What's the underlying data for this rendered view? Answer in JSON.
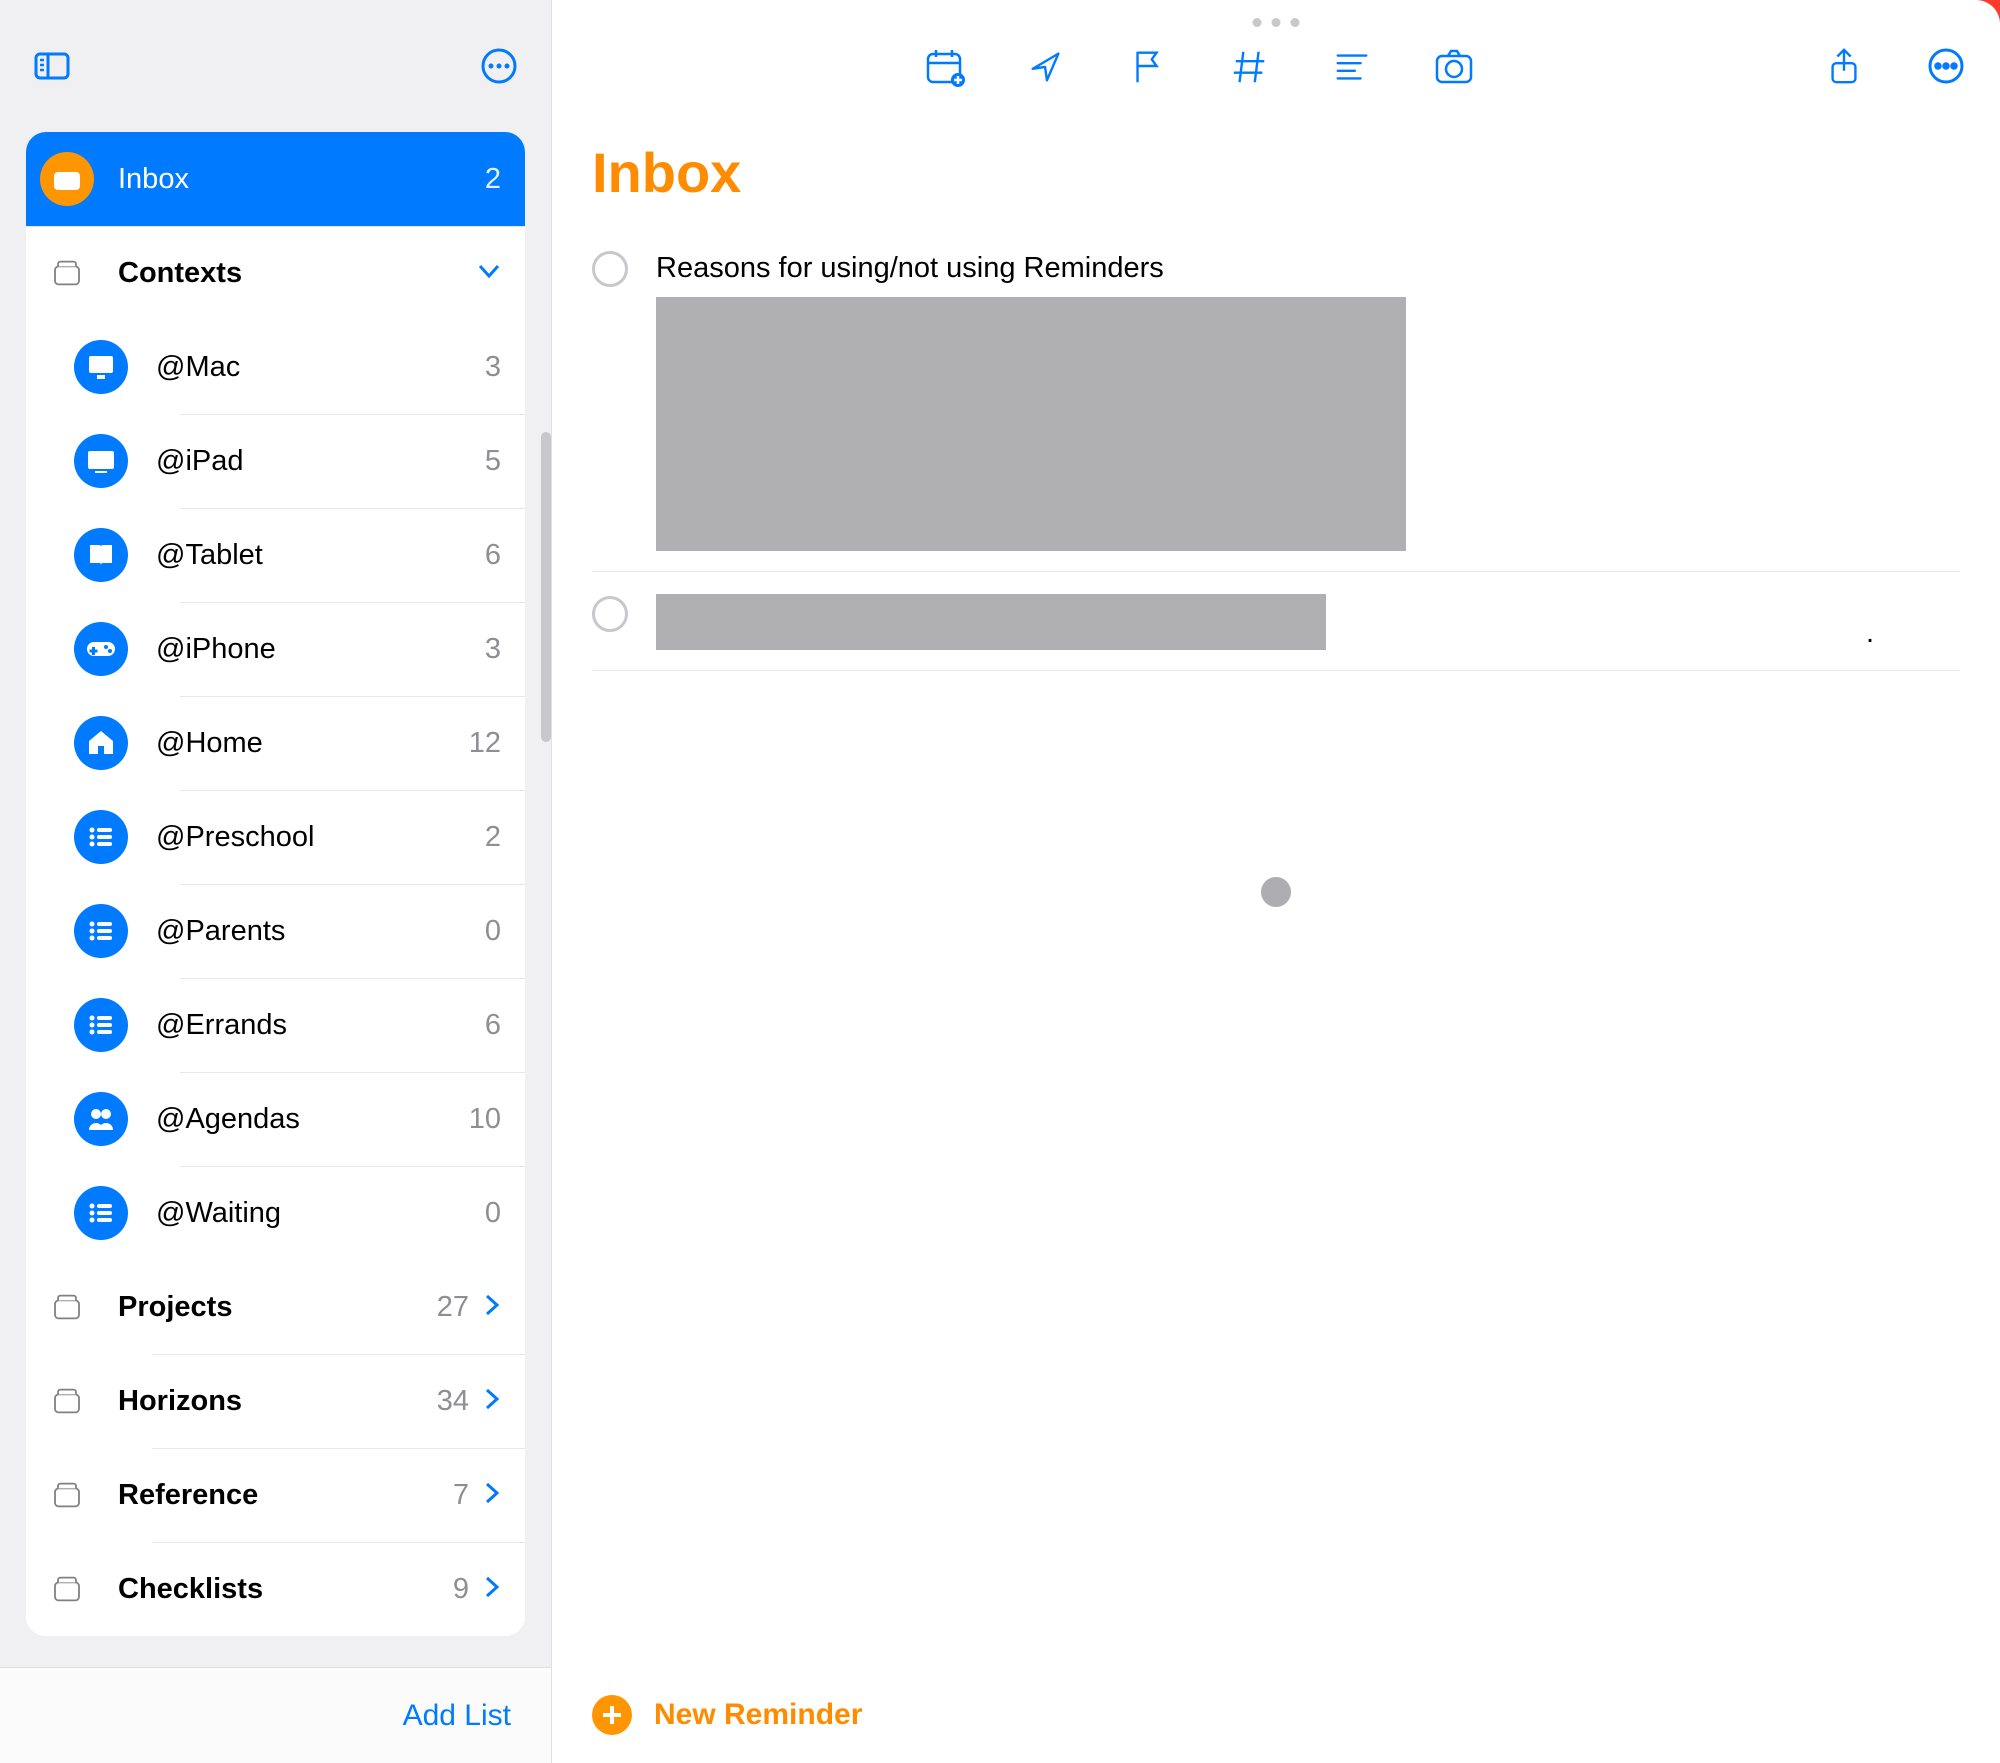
{
  "sidebar": {
    "inbox": {
      "label": "Inbox",
      "count": "2"
    },
    "contexts_label": "Contexts",
    "contexts": [
      {
        "label": "@Mac",
        "count": "3",
        "icon": "desktop"
      },
      {
        "label": "@iPad",
        "count": "5",
        "icon": "display"
      },
      {
        "label": "@Tablet",
        "count": "6",
        "icon": "book"
      },
      {
        "label": "@iPhone",
        "count": "3",
        "icon": "gamepad"
      },
      {
        "label": "@Home",
        "count": "12",
        "icon": "house"
      },
      {
        "label": "@Preschool",
        "count": "2",
        "icon": "list"
      },
      {
        "label": "@Parents",
        "count": "0",
        "icon": "list"
      },
      {
        "label": "@Errands",
        "count": "6",
        "icon": "list"
      },
      {
        "label": "@Agendas",
        "count": "10",
        "icon": "people"
      },
      {
        "label": "@Waiting",
        "count": "0",
        "icon": "list"
      }
    ],
    "folders": [
      {
        "label": "Projects",
        "count": "27"
      },
      {
        "label": "Horizons",
        "count": "34"
      },
      {
        "label": "Reference",
        "count": "7"
      },
      {
        "label": "Checklists",
        "count": "9"
      }
    ],
    "add_list": "Add List"
  },
  "main": {
    "title": "Inbox",
    "tasks": [
      {
        "title": "Reasons for using/not using Reminders"
      }
    ],
    "new_reminder": "New Reminder"
  }
}
